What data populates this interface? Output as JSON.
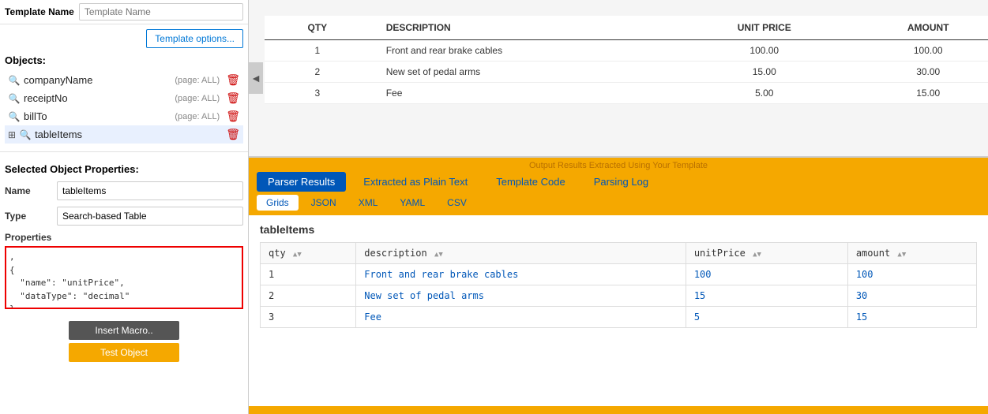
{
  "leftPanel": {
    "templateNameLabel": "Template Name",
    "templateNamePlaceholder": "Template Name",
    "templateOptionsBtn": "Template options...",
    "objectsTitle": "Objects:",
    "objects": [
      {
        "id": "companyName",
        "icon": "search",
        "name": "companyName",
        "page": "(page: ALL)",
        "type": "field"
      },
      {
        "id": "receiptNo",
        "icon": "search",
        "name": "receiptNo",
        "page": "(page: ALL)",
        "type": "field"
      },
      {
        "id": "billTo",
        "icon": "search",
        "name": "billTo",
        "page": "(page: ALL)",
        "type": "field"
      },
      {
        "id": "tableItems",
        "icon": "table-search",
        "name": "tableItems",
        "page": "",
        "type": "table",
        "selected": true
      }
    ],
    "selectedPropertiesTitle": "Selected Object Properties:",
    "namePropLabel": "Name",
    "namePropValue": "tableItems",
    "typePropLabel": "Type",
    "typePropValue": "Search-based Table",
    "propertiesLabel": "Properties",
    "propertiesCode": ",\n{\n  \"name\": \"unitPrice\",\n  \"dataType\": \"decimal\"\n},",
    "insertMacroBtn": "Insert Macro..",
    "testObjectBtn": "Test Object"
  },
  "docPreview": {
    "columns": [
      "QTY",
      "DESCRIPTION",
      "UNIT PRICE",
      "AMOUNT"
    ],
    "rows": [
      {
        "qty": "1",
        "desc": "Front and rear brake cables",
        "unitPrice": "100.00",
        "amount": "100.00"
      },
      {
        "qty": "2",
        "desc": "New set of pedal arms",
        "unitPrice": "15.00",
        "amount": "30.00"
      },
      {
        "qty": "3",
        "desc": "Fee",
        "unitPrice": "5.00",
        "amount": "15.00"
      }
    ],
    "scrollArrow": "◄"
  },
  "resultsArea": {
    "headerText": "Output Results Extracted Using Your Template",
    "tabs": [
      {
        "id": "parser",
        "label": "Parser Results",
        "active": true
      },
      {
        "id": "plain",
        "label": "Extracted as Plain Text",
        "active": false
      },
      {
        "id": "template",
        "label": "Template Code",
        "active": false
      },
      {
        "id": "log",
        "label": "Parsing Log",
        "active": false
      }
    ],
    "subtabs": [
      {
        "id": "grids",
        "label": "Grids",
        "active": true
      },
      {
        "id": "json",
        "label": "JSON",
        "active": false
      },
      {
        "id": "xml",
        "label": "XML",
        "active": false
      },
      {
        "id": "yaml",
        "label": "YAML",
        "active": false
      },
      {
        "id": "csv",
        "label": "CSV",
        "active": false
      }
    ],
    "gridTableTitle": "tableItems",
    "gridColumns": [
      {
        "id": "qty",
        "label": "qty"
      },
      {
        "id": "description",
        "label": "description"
      },
      {
        "id": "unitPrice",
        "label": "unitPrice"
      },
      {
        "id": "amount",
        "label": "amount"
      }
    ],
    "gridRows": [
      {
        "qty": "1",
        "description": "Front and rear brake cables",
        "unitPrice": "100",
        "amount": "100"
      },
      {
        "qty": "2",
        "description": "New set of pedal arms",
        "unitPrice": "15",
        "amount": "30"
      },
      {
        "qty": "3",
        "description": "Fee",
        "unitPrice": "5",
        "amount": "15"
      }
    ]
  }
}
